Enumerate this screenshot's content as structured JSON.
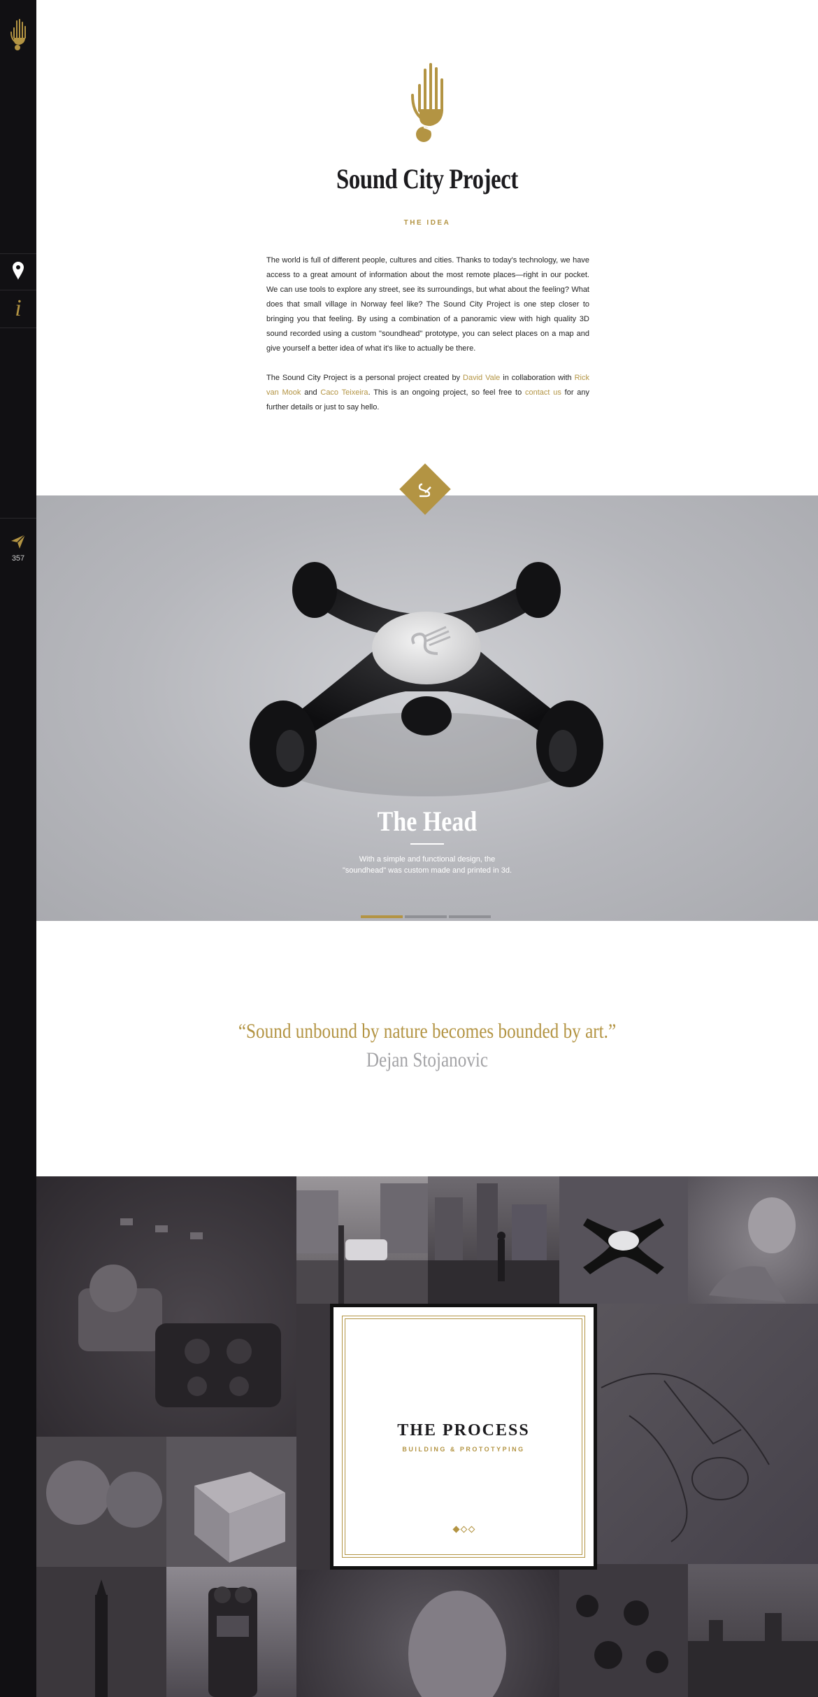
{
  "sidebar": {
    "logo_icon": "hand-logo-icon",
    "map_icon": "map-pin-icon",
    "info_label": "i",
    "share_icon": "paper-plane-icon",
    "share_count": "357"
  },
  "hero": {
    "logo_icon": "hand-logo-icon",
    "title": "Sound City Project",
    "subtitle": "THE IDEA",
    "paragraph1": "The world is full of different people, cultures and cities. Thanks to today's technology, we have access to a great amount of information about the most remote places—right in our pocket. We can use tools to explore any street, see its surroundings, but what about the feeling? What does that small village in Norway feel like? The Sound City Project is one step closer to bringing you that feeling. By using a combination of a panoramic view with high quality 3D sound recorded using a custom \"soundhead\" prototype, you can select places on a map and give yourself a better idea of what it's like to actually be there.",
    "p2_text1": "The Sound City Project is a personal project created by ",
    "p2_link1": "David Vale",
    "p2_text2": " in collaboration with ",
    "p2_link2": "Rick van Mook",
    "p2_text3": " and ",
    "p2_link3": "Caco Teixeira",
    "p2_text4": ". This is an ongoing project, so feel free to ",
    "p2_link4": "contact us",
    "p2_text5": " for any further details or just to say hello."
  },
  "head": {
    "badge_icon": "swan-logo-icon",
    "title": "The Head",
    "description": "With a simple and functional design, the \"soundhead\" was custom made and printed in 3d.",
    "slides": 3,
    "active_slide": 1
  },
  "quote": {
    "text": "“Sound unbound by nature becomes bounded by art.”",
    "author": "Dejan Stojanovic"
  },
  "process": {
    "title": "THE PROCESS",
    "subtitle": "BUILDING & PROTOTYPING",
    "dots": 3,
    "active_dot": 1
  },
  "colors": {
    "accent": "#b39443",
    "sidebar": "#111013",
    "head_bg": "#b6b7bc",
    "gallery_bg": "#3a363b"
  }
}
